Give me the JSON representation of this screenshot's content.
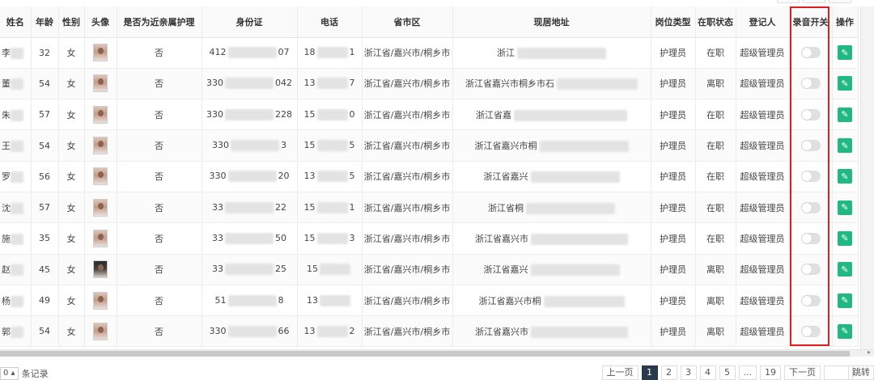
{
  "headers": [
    "姓名",
    "年龄",
    "性别",
    "头像",
    "是否为近亲属护理",
    "身份证",
    "电话",
    "省市区",
    "现居地址",
    "岗位类型",
    "在职状态",
    "登记人",
    "录音开关",
    "操作"
  ],
  "rows": [
    {
      "name": "李",
      "age": "32",
      "gender": "女",
      "relative": "否",
      "id_prefix": "412",
      "id_suffix": "07",
      "phone_prefix": "18",
      "phone_suffix": "1",
      "region": "浙江省/嘉兴市/桐乡市",
      "address": "浙江",
      "post": "护理员",
      "status": "在职",
      "registrar": "超级管理员"
    },
    {
      "name": "董",
      "age": "54",
      "gender": "女",
      "relative": "否",
      "id_prefix": "330",
      "id_suffix": "042",
      "phone_prefix": "13",
      "phone_suffix": "7",
      "region": "浙江省/嘉兴市/桐乡市",
      "address": "浙江省嘉兴市桐乡市石",
      "post": "护理员",
      "status": "离职",
      "registrar": "超级管理员"
    },
    {
      "name": "朱",
      "age": "57",
      "gender": "女",
      "relative": "否",
      "id_prefix": "330",
      "id_suffix": "228",
      "phone_prefix": "15",
      "phone_suffix": "0",
      "region": "浙江省/嘉兴市/桐乡市",
      "address": "浙江省嘉",
      "post": "护理员",
      "status": "在职",
      "registrar": "超级管理员"
    },
    {
      "name": "王",
      "age": "54",
      "gender": "女",
      "relative": "否",
      "id_prefix": "330",
      "id_suffix": "3",
      "phone_prefix": "15",
      "phone_suffix": "5",
      "region": "浙江省/嘉兴市/桐乡市",
      "address": "浙江省嘉兴市桐",
      "post": "护理员",
      "status": "在职",
      "registrar": "超级管理员"
    },
    {
      "name": "罗",
      "age": "56",
      "gender": "女",
      "relative": "否",
      "id_prefix": "330",
      "id_suffix": "20",
      "phone_prefix": "13",
      "phone_suffix": "5",
      "region": "浙江省/嘉兴市/桐乡市",
      "address": "浙江省嘉兴",
      "post": "护理员",
      "status": "在职",
      "registrar": "超级管理员"
    },
    {
      "name": "沈",
      "age": "57",
      "gender": "女",
      "relative": "否",
      "id_prefix": "33",
      "id_suffix": "22",
      "phone_prefix": "15",
      "phone_suffix": "1",
      "region": "浙江省/嘉兴市/桐乡市",
      "address": "浙江省桐",
      "post": "护理员",
      "status": "在职",
      "registrar": "超级管理员"
    },
    {
      "name": "施",
      "age": "35",
      "gender": "女",
      "relative": "否",
      "id_prefix": "33",
      "id_suffix": "50",
      "phone_prefix": "15",
      "phone_suffix": "3",
      "region": "浙江省/嘉兴市/桐乡市",
      "address": "浙江省嘉兴市",
      "post": "护理员",
      "status": "在职",
      "registrar": "超级管理员"
    },
    {
      "name": "赵",
      "age": "45",
      "gender": "女",
      "relative": "否",
      "id_prefix": "33",
      "id_suffix": "25",
      "phone_prefix": "15",
      "phone_suffix": "",
      "region": "浙江省/嘉兴市/桐乡市",
      "address": "浙江省嘉兴",
      "post": "护理员",
      "status": "离职",
      "registrar": "超级管理员"
    },
    {
      "name": "杨",
      "age": "49",
      "gender": "女",
      "relative": "否",
      "id_prefix": "51",
      "id_suffix": "8",
      "phone_prefix": "13",
      "phone_suffix": "",
      "region": "浙江省/嘉兴市/桐乡市",
      "address": "浙江省嘉兴市桐",
      "post": "护理员",
      "status": "离职",
      "registrar": "超级管理员"
    },
    {
      "name": "郭",
      "age": "54",
      "gender": "女",
      "relative": "否",
      "id_prefix": "330",
      "id_suffix": "66",
      "phone_prefix": "13",
      "phone_suffix": "2",
      "region": "浙江省/嘉兴市/桐乡市",
      "address": "浙江省嘉兴市",
      "post": "护理员",
      "status": "离职",
      "registrar": "超级管理员"
    }
  ],
  "pagination": {
    "page_size_label": "0",
    "records_label": "条记录",
    "prev": "上一页",
    "pages": [
      "1",
      "2",
      "3",
      "4",
      "5",
      "...",
      "19"
    ],
    "next": "下一页",
    "jump": "跳转"
  },
  "icons": {
    "edit": "pencil-icon"
  },
  "colors": {
    "edit_button": "#1fb981",
    "highlight": "#e01e1e",
    "active_page": "#2b3a4a"
  }
}
